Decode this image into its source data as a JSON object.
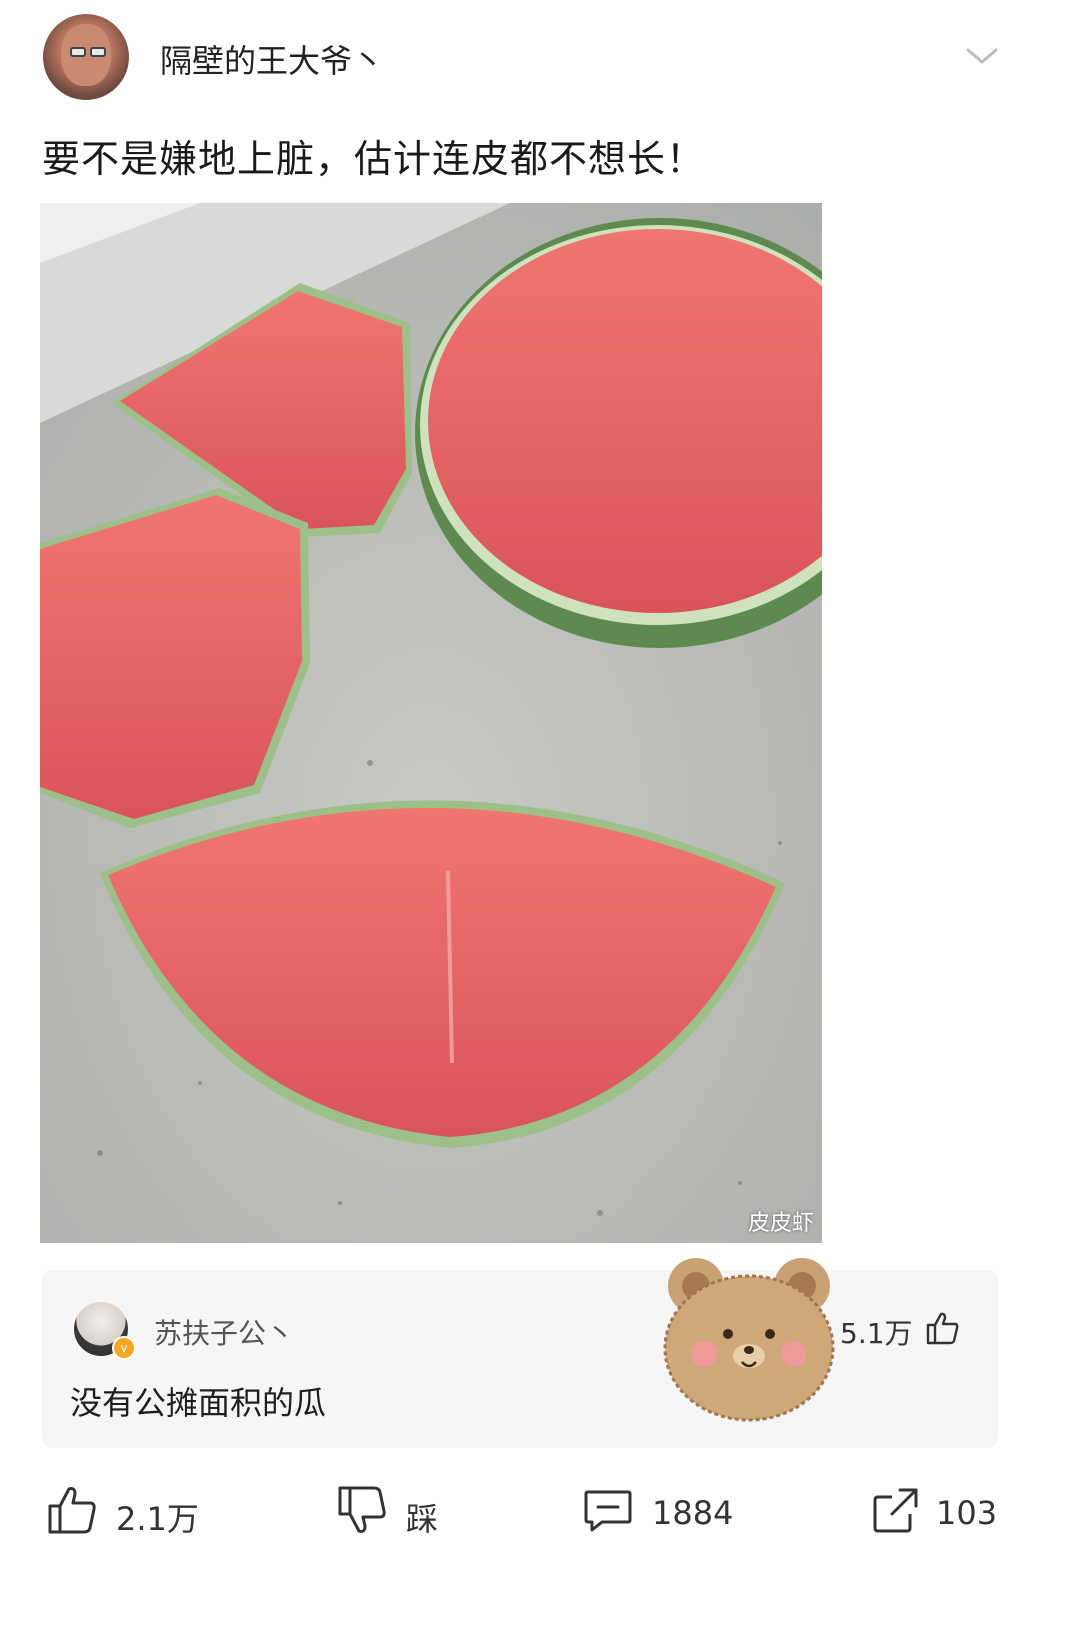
{
  "post": {
    "username": "隔壁的王大爷丶",
    "text": "要不是嫌地上脏，估计连皮都不想长！",
    "image_watermark": "皮皮虾",
    "image_icon": "watermelon-photo"
  },
  "top_comment": {
    "username": "苏扶子公丶",
    "text": "没有公摊面积的瓜",
    "likes": "5.1万",
    "badge_icon": "verified-badge-icon",
    "sticker_icon": "bear-sticker-icon"
  },
  "actions": {
    "like_count": "2.1万",
    "dislike_label": "踩",
    "comment_count": "1884",
    "share_count": "103"
  },
  "colors": {
    "accent": "#f5a623",
    "flesh": "#e86a66",
    "rind": "#7fa56a",
    "counter": "#b9bcb8"
  }
}
